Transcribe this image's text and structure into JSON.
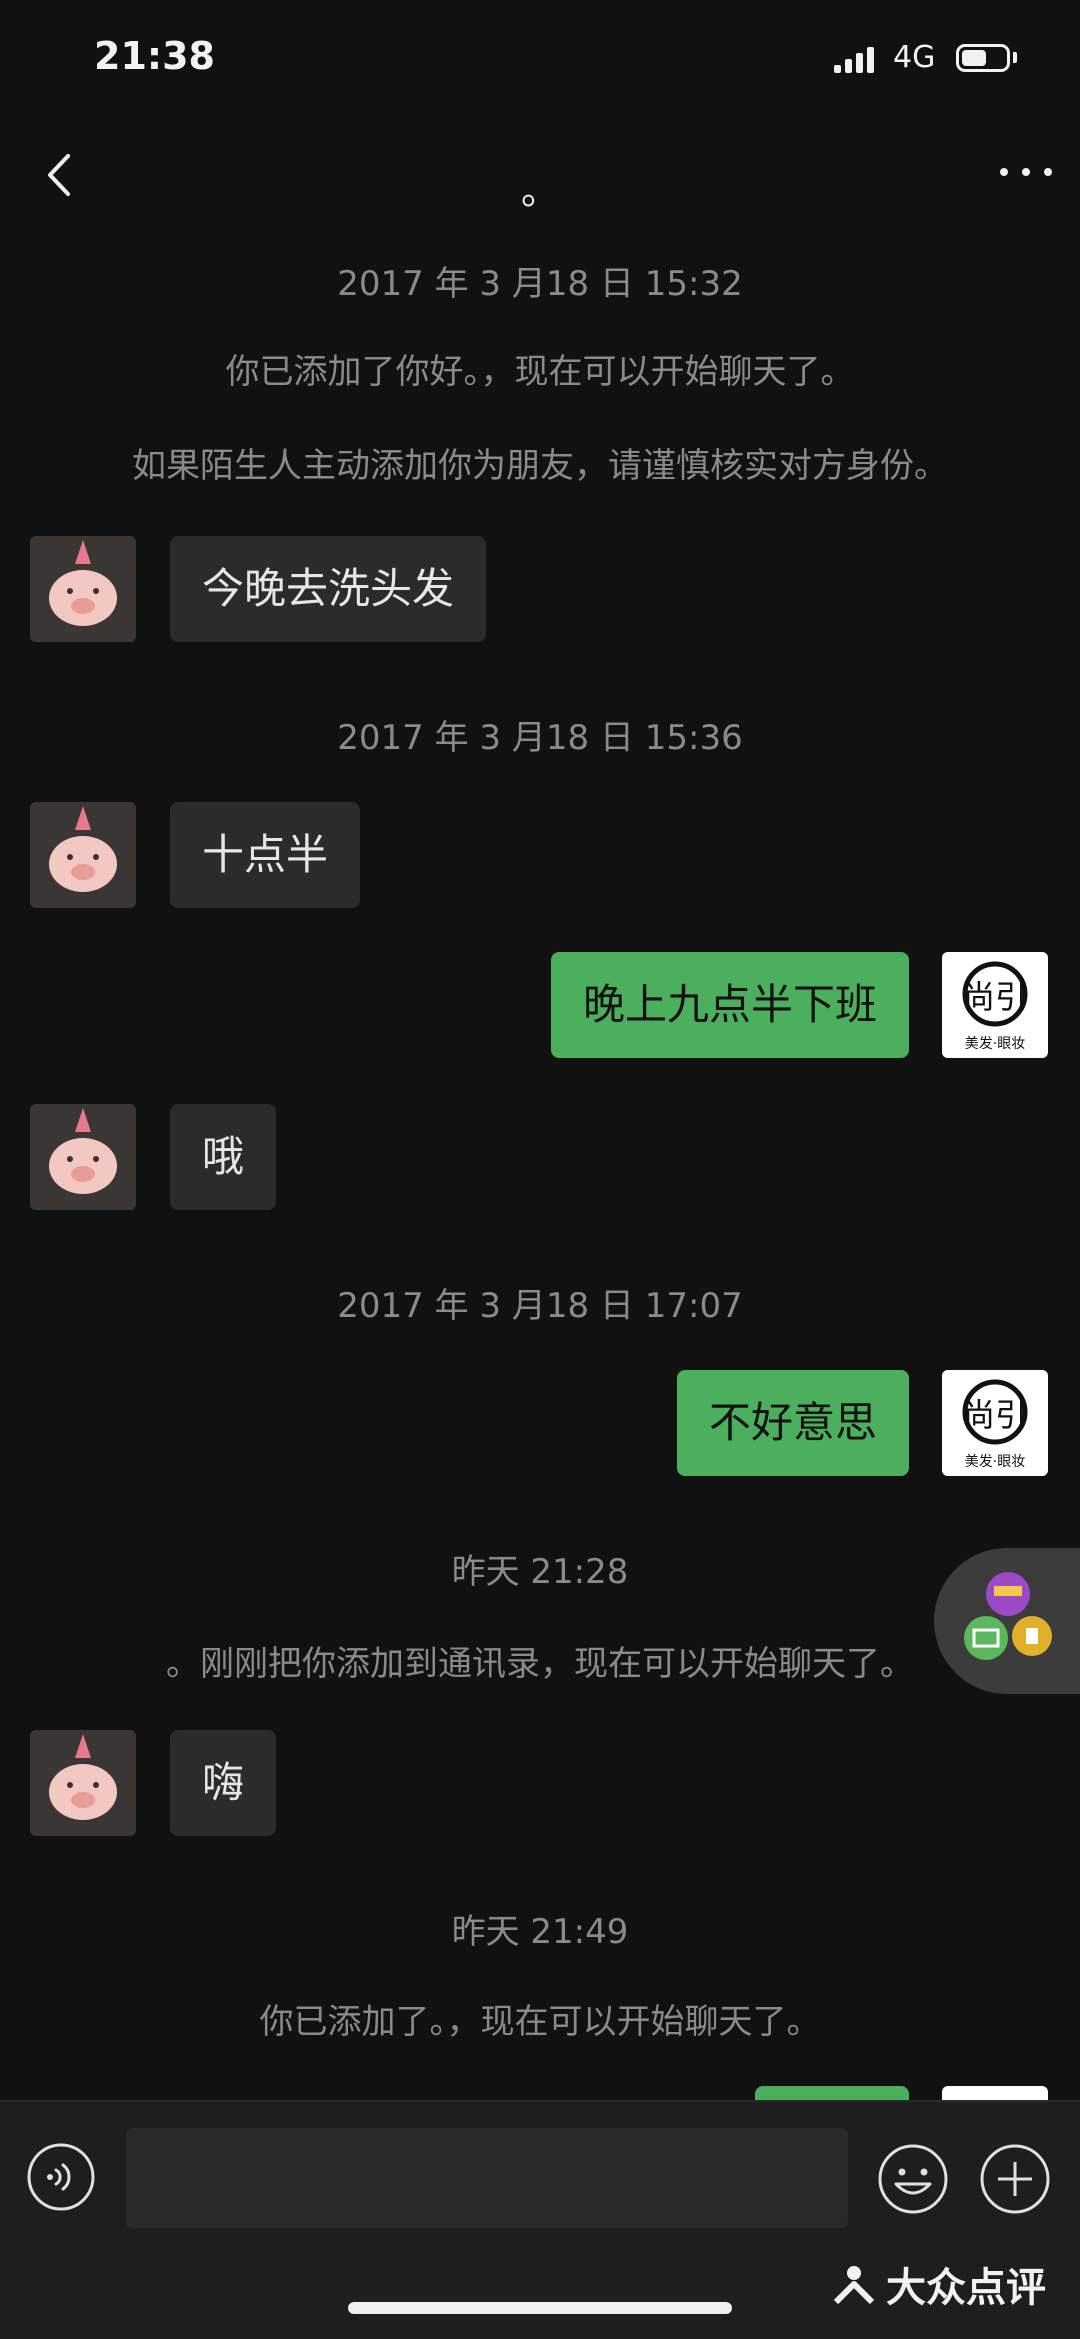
{
  "status_bar": {
    "time": "21:38",
    "network": "4G"
  },
  "header": {
    "title": "。"
  },
  "messages": {
    "ts1": "2017 年 3 月18 日 15:32",
    "sys1": "你已添加了你好。，现在可以开始聊天了。",
    "sys2": "如果陌生人主动添加你为朋友，请谨慎核实对方身份。",
    "m1": "今晚去洗头发",
    "ts2": "2017 年 3 月18 日 15:36",
    "m2": "十点半",
    "m3": "晚上九点半下班",
    "m4": "哦",
    "ts3": "2017 年 3 月18 日 17:07",
    "m5": "不好意思",
    "ts4": "昨天 21:28",
    "sys3": "。刚刚把你添加到通讯录，现在可以开始聊天了。",
    "m6": "嗨",
    "ts5": "昨天 21:49",
    "sys4": "你已添加了。，现在可以开始聊天了。"
  },
  "logo_text": {
    "main": "尚引",
    "sub": "美发·眼妆"
  },
  "input": {
    "placeholder": ""
  },
  "watermark": "大众点评",
  "colors": {
    "background": "#111111",
    "outgoing_bubble": "#4caf5e",
    "incoming_bubble": "#2b2b2b"
  }
}
